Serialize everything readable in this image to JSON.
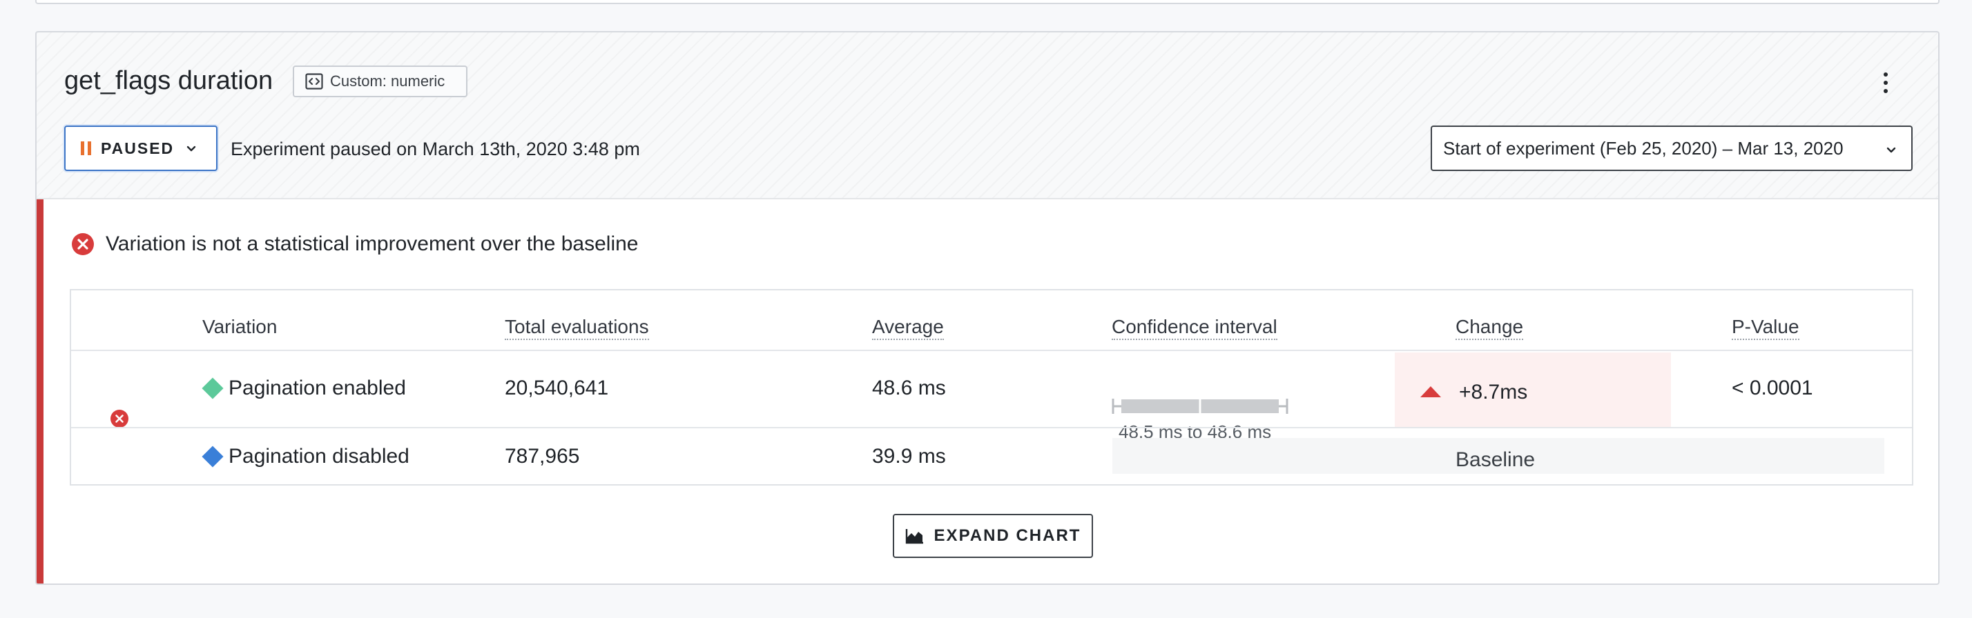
{
  "metric": {
    "title": "get_flags duration",
    "type_label": "Custom: numeric"
  },
  "status": {
    "label": "PAUSED",
    "note": "Experiment paused on March 13th, 2020 3:48 pm"
  },
  "date_range": {
    "label": "Start of experiment (Feb 25, 2020) – Mar 13, 2020"
  },
  "verdict": {
    "text": "Variation is not a statistical improvement over the baseline"
  },
  "table": {
    "headers": [
      "Variation",
      "Total evaluations",
      "Average",
      "Confidence interval",
      "Change",
      "P-Value"
    ],
    "rows": [
      {
        "variation": "Pagination enabled",
        "color": "#5cc99a",
        "evaluations": "20,540,641",
        "average": "48.6 ms",
        "ci_label": "48.5 ms to 48.6 ms",
        "change": "+8.7ms",
        "pvalue": "< 0.0001"
      },
      {
        "variation": "Pagination disabled",
        "color": "#3a7fd8",
        "evaluations": "787,965",
        "average": "39.9 ms",
        "baseline_label": "Baseline"
      }
    ]
  },
  "expand_chart": {
    "label": "EXPAND CHART"
  },
  "colors": {
    "accent_blue": "#3b74c6",
    "paused_orange": "#e8712f",
    "negative_red": "#c93a3a"
  }
}
